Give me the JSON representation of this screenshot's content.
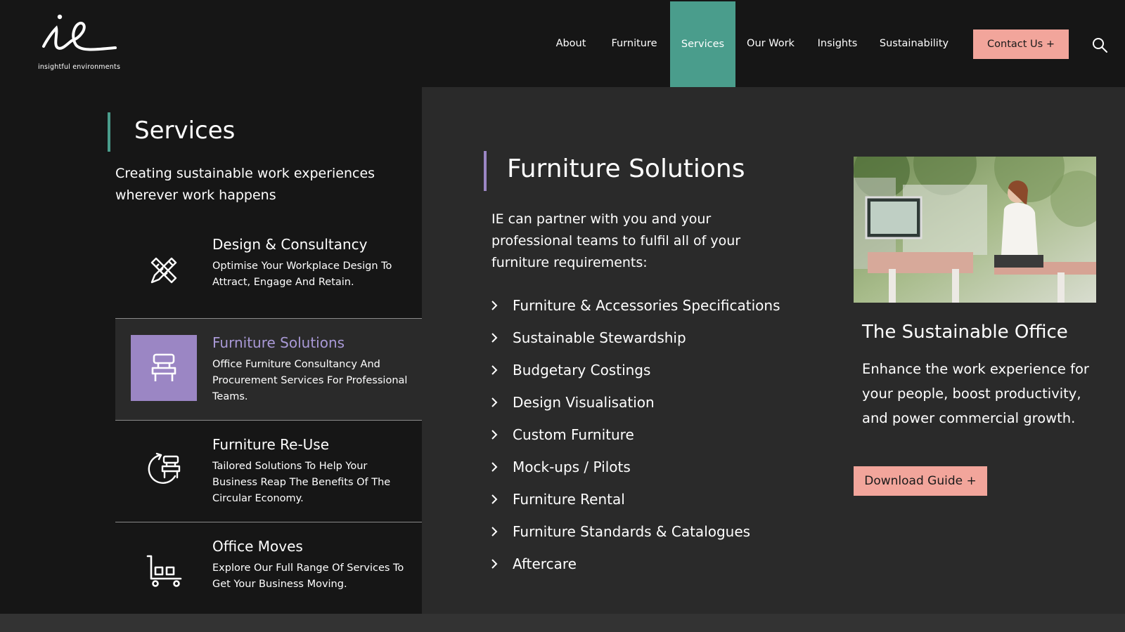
{
  "brand": {
    "logo_text": "insightful environments"
  },
  "nav": {
    "items": [
      {
        "label": "About"
      },
      {
        "label": "Furniture"
      },
      {
        "label": "Services"
      },
      {
        "label": "Our Work"
      },
      {
        "label": "Insights"
      },
      {
        "label": "Sustainability"
      }
    ],
    "active_label": "Services",
    "contact_label": "Contact Us +"
  },
  "left": {
    "title": "Services",
    "subtitle": "Creating sustainable work experiences wherever work happens",
    "services": [
      {
        "title": "Design & Consultancy",
        "desc": "Optimise Your Workplace Design To Attract, Engage And Retain.",
        "icon": "design-tools-icon"
      },
      {
        "title": "Furniture Solutions",
        "desc": "Office Furniture Consultancy And Procurement Services For Professional Teams.",
        "icon": "chair-icon"
      },
      {
        "title": "Furniture Re-Use",
        "desc": "Tailored Solutions To Help Your Business Reap The Benefits Of The Circular Economy.",
        "icon": "circular-chair-icon"
      },
      {
        "title": "Office Moves",
        "desc": "Explore Our Full Range Of Services To Get Your Business Moving.",
        "icon": "trolley-icon"
      }
    ]
  },
  "middle": {
    "title": "Furniture Solutions",
    "intro": "IE can partner with you and your professional teams to fulfil all of your furniture requirements:",
    "list": [
      "Furniture & Accessories Specifications",
      "Sustainable Stewardship",
      "Budgetary Costings",
      "Design Visualisation",
      "Custom Furniture",
      "Mock-ups / Pilots",
      "Furniture Rental",
      "Furniture Standards & Catalogues",
      "Aftercare"
    ]
  },
  "promo": {
    "title": "The Sustainable Office",
    "text": "Enhance the work experience for your people, boost productivity, and power commercial growth.",
    "button_label": "Download Guide +"
  },
  "colors": {
    "teal_accent": "#4a9d8c",
    "purple_accent": "#9b86c4",
    "salmon_button": "#f2a59b",
    "dark_bg": "#161616",
    "panel_bg": "#2a2a2a"
  }
}
